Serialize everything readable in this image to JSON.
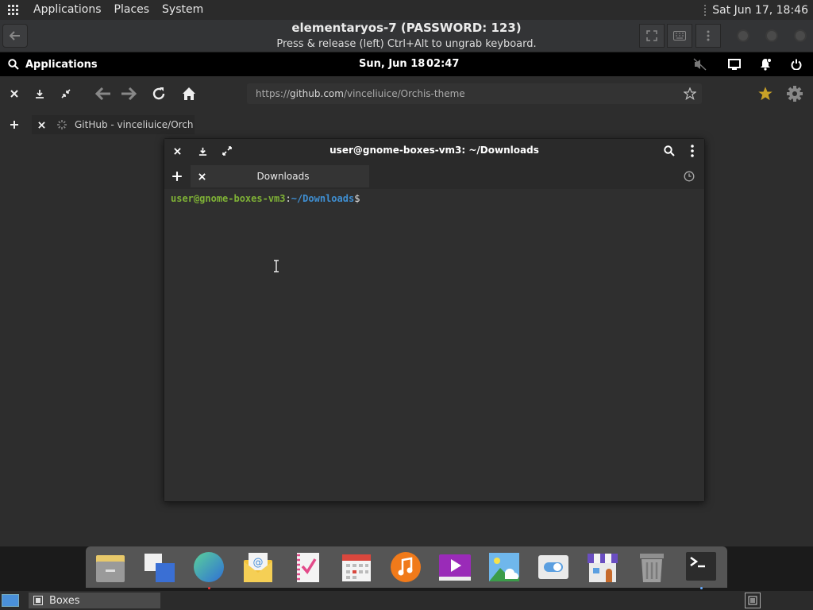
{
  "host_panel": {
    "menus": [
      "Applications",
      "Places",
      "System"
    ],
    "clock": "Sat Jun 17, 18:46"
  },
  "boxes_header": {
    "title": "elementaryos-7 (PASSWORD: 123)",
    "subtitle": "Press & release (left) Ctrl+Alt to ungrab keyboard."
  },
  "guest_panel": {
    "applications_label": "Applications",
    "date": "Sun, Jun 18",
    "time": "02:47"
  },
  "browser": {
    "url_prefix": "https://",
    "url_domain": "github.com",
    "url_path": "/vinceliuice/Orchis-theme",
    "tab_title": "GitHub - vinceliuice/Orchi"
  },
  "terminal": {
    "title": "user@gnome-boxes-vm3: ~/Downloads",
    "tab_label": "Downloads",
    "prompt_user": "user@gnome-boxes-vm3",
    "prompt_colon": ":",
    "prompt_path": "~/Downloads",
    "prompt_dollar": "$"
  },
  "dock": {
    "apps": [
      "files-icon",
      "multitasking-icon",
      "web-browser-icon",
      "mail-icon",
      "tasks-icon",
      "calendar-icon",
      "music-icon",
      "videos-icon",
      "photos-icon",
      "settings-icon",
      "appcenter-icon",
      "trash-icon",
      "terminal-icon"
    ]
  },
  "host_taskbar": {
    "task_label": "Boxes"
  },
  "colors": {
    "accent_blue": "#4a90d9",
    "prompt_green": "#7fb236",
    "prompt_blue": "#3f8fd2",
    "bookmark_gold": "#c9a227"
  }
}
